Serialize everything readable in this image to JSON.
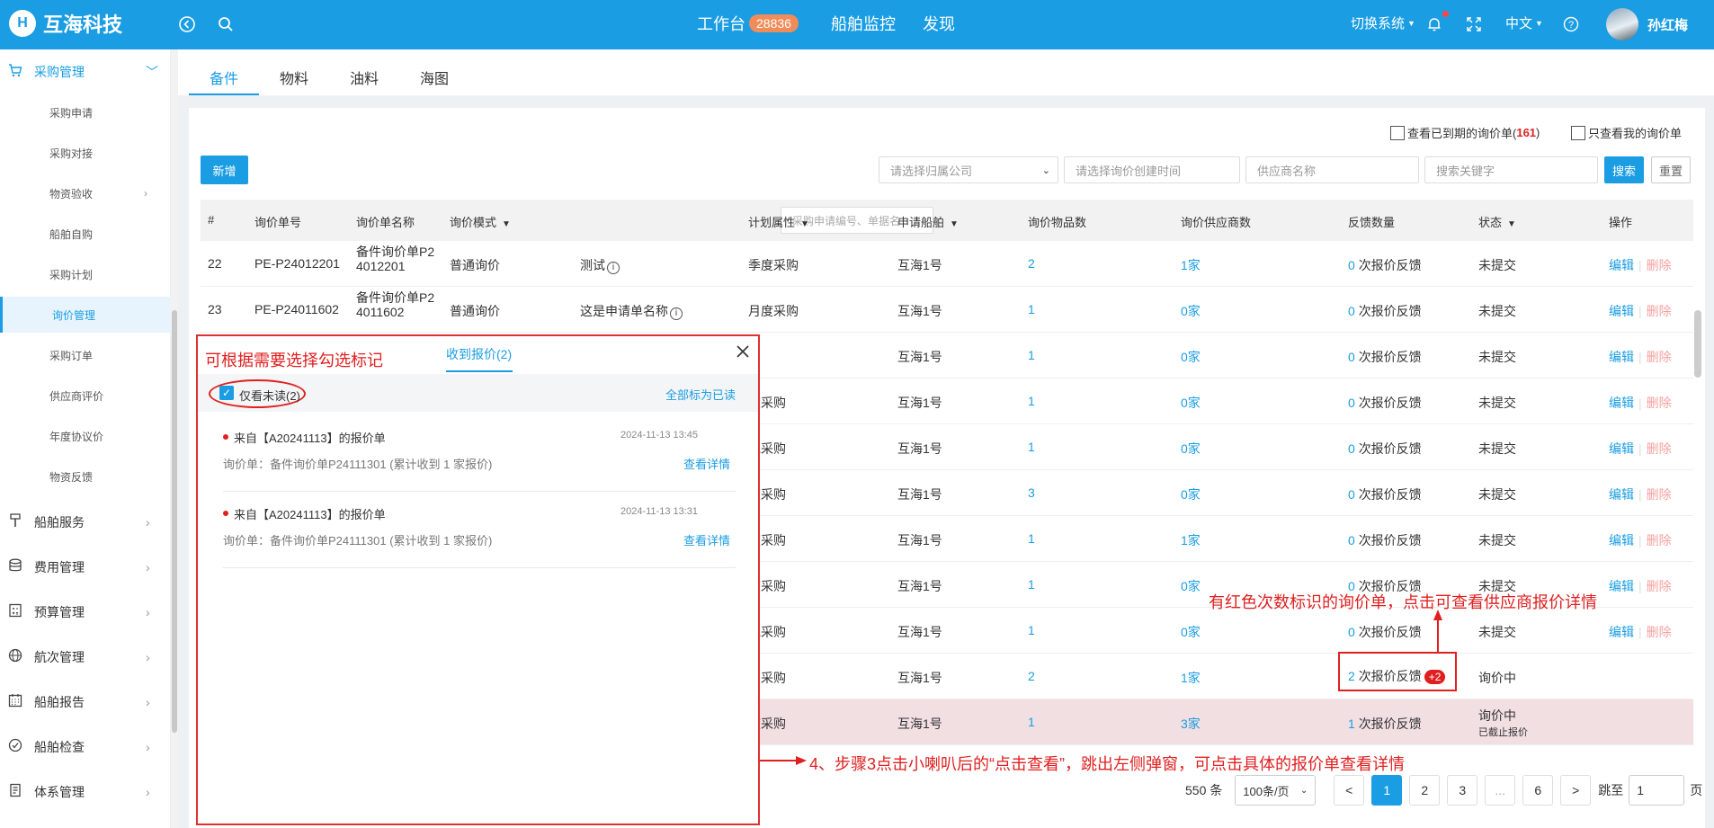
{
  "topbar": {
    "logo_mark": "H",
    "brand": "互海科技",
    "nav": [
      {
        "label": "工作台",
        "badge": "28836"
      },
      {
        "label": "船舶监控"
      },
      {
        "label": "发现"
      }
    ],
    "switch_system": "切换系统",
    "language": "中文",
    "user_name": "孙红梅"
  },
  "sidebar": {
    "main_group": "采购管理",
    "sub_items": [
      "采购申请",
      "采购对接",
      "物资验收",
      "船舶自购",
      "采购计划",
      "询价管理",
      "采购订单",
      "供应商评价",
      "年度协议价",
      "物资反馈"
    ],
    "active_sub": "询价管理",
    "groups": [
      "船舶服务",
      "费用管理",
      "预算管理",
      "航次管理",
      "船舶报告",
      "船舶检查",
      "体系管理"
    ]
  },
  "tabs": [
    "备件",
    "物料",
    "油料",
    "海图"
  ],
  "active_tab": "备件",
  "filters": {
    "expired_label": "查看已到期的询价单(",
    "expired_count": "161",
    "expired_close": ")",
    "mine_label": "只查看我的询价单",
    "new_button": "新增",
    "company_placeholder": "请选择归属公司",
    "date_placeholder": "请选择询价创建时间",
    "supplier_placeholder": "供应商名称",
    "keyword_placeholder": "搜索关键字",
    "search_button": "搜索",
    "reset_button": "重置"
  },
  "table": {
    "headers": [
      "#",
      "询价单号",
      "询价单名称",
      "询价模式",
      "采购申请编号、单据名",
      "计划属性",
      "申请船舶",
      "询价物品数",
      "询价供应商数",
      "反馈数量",
      "状态",
      "操作"
    ],
    "edit_label": "编辑",
    "delete_label": "删除",
    "feedback_suffix": "次报价反馈",
    "rows": [
      {
        "no": "22",
        "code": "PE-P24012201",
        "name_line1": "备件询价单P2",
        "name_line2": "4012201",
        "mode": "普通询价",
        "apply": "测试",
        "plan": "季度采购",
        "ship": "互海1号",
        "items": "2",
        "suppliers": "1家",
        "feedback": "0",
        "status": "未提交"
      },
      {
        "no": "23",
        "code": "PE-P24011602",
        "name_line1": "备件询价单P2",
        "name_line2": "4011602",
        "mode": "普通询价",
        "apply": "这是申请单名称",
        "plan": "月度采购",
        "ship": "互海1号",
        "items": "1",
        "suppliers": "0家",
        "feedback": "0",
        "status": "未提交"
      },
      {
        "plan": "",
        "ship": "互海1号",
        "items": "1",
        "suppliers": "0家",
        "feedback": "0",
        "status": "未提交"
      },
      {
        "plan": "度采购",
        "ship": "互海1号",
        "items": "1",
        "suppliers": "0家",
        "feedback": "0",
        "status": "未提交"
      },
      {
        "plan": "他采购",
        "ship": "互海1号",
        "items": "1",
        "suppliers": "0家",
        "feedback": "0",
        "status": "未提交"
      },
      {
        "plan": "度采购",
        "ship": "互海1号",
        "items": "3",
        "suppliers": "0家",
        "feedback": "0",
        "status": "未提交"
      },
      {
        "plan": "度采购",
        "ship": "互海1号",
        "items": "1",
        "suppliers": "1家",
        "feedback": "0",
        "status": "未提交"
      },
      {
        "plan": "度采购",
        "ship": "互海1号",
        "items": "1",
        "suppliers": "0家",
        "feedback": "0",
        "status": "未提交"
      },
      {
        "plan": "他采购",
        "ship": "互海1号",
        "items": "1",
        "suppliers": "0家",
        "feedback": "0",
        "status": "未提交"
      },
      {
        "plan": "星采购",
        "ship": "互海1号",
        "items": "2",
        "suppliers": "1家",
        "feedback": "2",
        "badge": "+2",
        "status": "询价中"
      },
      {
        "plan": "度采购",
        "ship": "互海1号",
        "items": "1",
        "suppliers": "3家",
        "feedback": "1",
        "status": "询价中",
        "status_sub": "已截止报价"
      }
    ]
  },
  "pagination": {
    "total": "550 条",
    "page_size": "100条/页",
    "prev": "<",
    "pages": [
      "1",
      "2",
      "3",
      "...",
      "6"
    ],
    "next": ">",
    "goto_label": "跳至",
    "goto_value": "1",
    "page_unit": "页"
  },
  "popup": {
    "annotation_title": "可根据需要选择勾选标记",
    "tab_label": "收到报价(2)",
    "unread_label": "仅看未读(2)",
    "mark_all_read": "全部标为已读",
    "messages": [
      {
        "title": "来自【A20241113】的报价单",
        "time": "2024-11-13 13:45",
        "body": "询价单：备件询价单P24111301 (累计收到 1 家报价)",
        "link": "查看详情"
      },
      {
        "title": "来自【A20241113】的报价单",
        "time": "2024-11-13 13:31",
        "body": "询价单：备件询价单P24111301 (累计收到 1 家报价)",
        "link": "查看详情"
      }
    ]
  },
  "annotations": {
    "red_badge_note": "有红色次数标识的询价单，点击可查看供应商报价详情",
    "step4_note": "4、步骤3点击小喇叭后的“点击查看”，跳出左侧弹窗，可点击具体的报价单查看详情"
  },
  "colors": {
    "primary": "#1a9de3",
    "annotation": "#e02020",
    "highlight_row": "#f2dfe2"
  }
}
